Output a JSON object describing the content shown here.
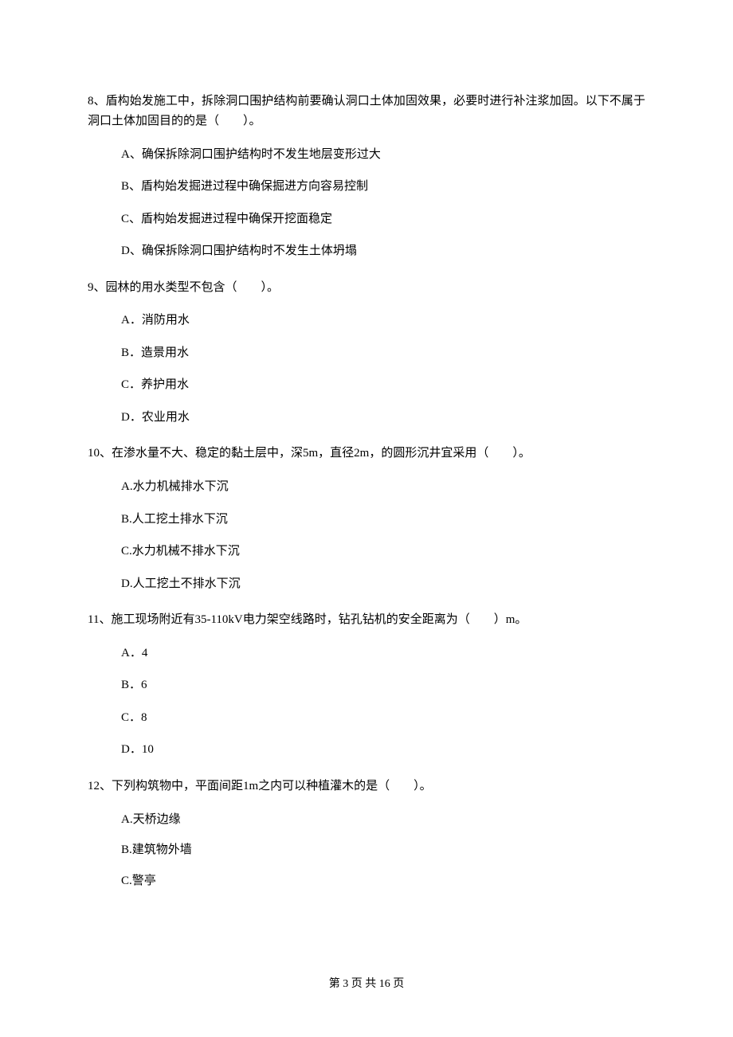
{
  "questions": [
    {
      "num": "8、",
      "text": "盾构始发施工中，拆除洞口围护结构前要确认洞口土体加固效果，必要时进行补注浆加固。以下不属于洞口土体加固目的的是（　　）。",
      "options": [
        "A、确保拆除洞口围护结构时不发生地层变形过大",
        "B、盾构始发掘进过程中确保掘进方向容易控制",
        "C、盾构始发掘进过程中确保开挖面稳定",
        "D、确保拆除洞口围护结构时不发生土体坍塌"
      ]
    },
    {
      "num": "9、",
      "text": "园林的用水类型不包含（　　）。",
      "options": [
        "A．消防用水",
        "B．造景用水",
        "C．养护用水",
        "D．农业用水"
      ]
    },
    {
      "num": "10、",
      "text": "在渗水量不大、稳定的黏土层中，深5m，直径2m，的圆形沉井宜采用（　　）。",
      "options": [
        "A.水力机械排水下沉",
        "B.人工挖土排水下沉",
        "C.水力机械不排水下沉",
        "D.人工挖土不排水下沉"
      ]
    },
    {
      "num": "11、",
      "text": "施工现场附近有35-110kV电力架空线路时，钻孔钻机的安全距离为（　　）m。",
      "options": [
        "A．4",
        "B．6",
        "C．8",
        "D．10"
      ]
    },
    {
      "num": "12、",
      "text": "下列构筑物中，平面间距1m之内可以种植灌木的是（　　）。",
      "options": [
        "A.天桥边缘",
        "B.建筑物外墙",
        "C.警亭"
      ]
    }
  ],
  "footer": "第 3 页 共 16 页"
}
